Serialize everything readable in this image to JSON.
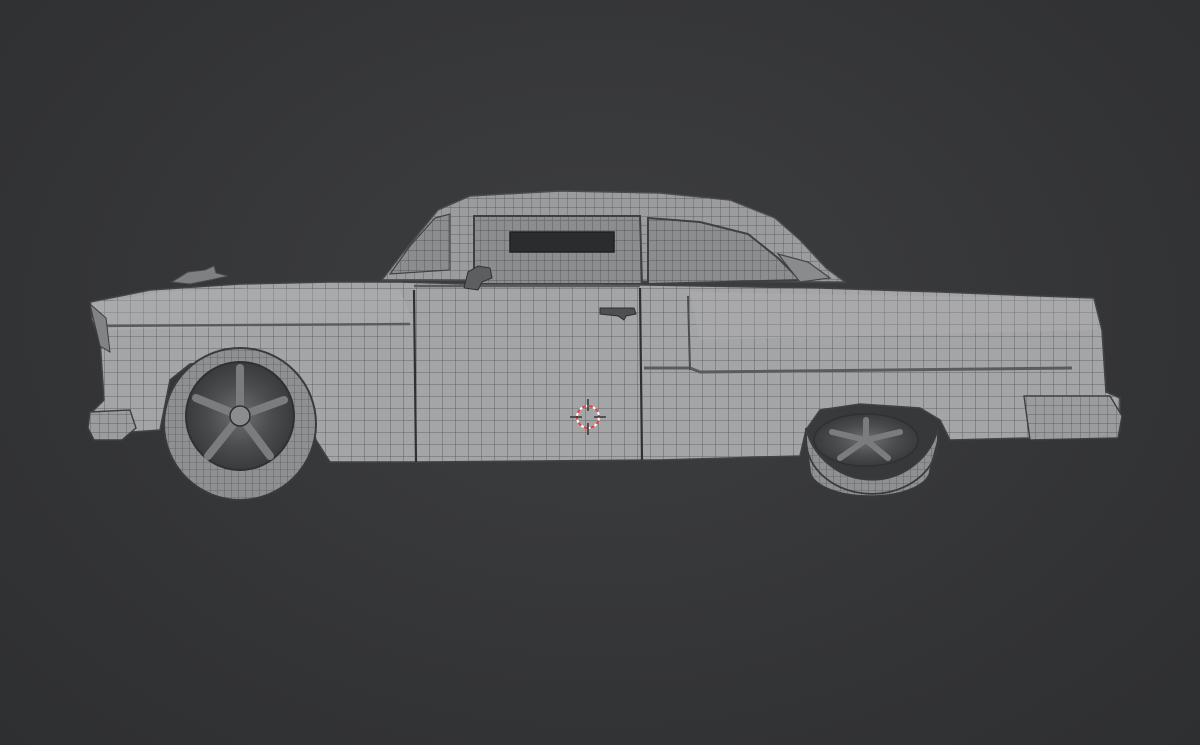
{
  "viewport": {
    "background_color": "#333436",
    "mesh_base_color": "#9fa0a2",
    "wire_color": "#4a4b4d",
    "cursor_colors": [
      "#e2433f",
      "#ffffff"
    ]
  },
  "scene": {
    "object": "car-body-wireframe-mesh",
    "view": "side",
    "shading": "solid-with-wireframe-overlay",
    "icons": [
      "3d-cursor-icon"
    ]
  }
}
